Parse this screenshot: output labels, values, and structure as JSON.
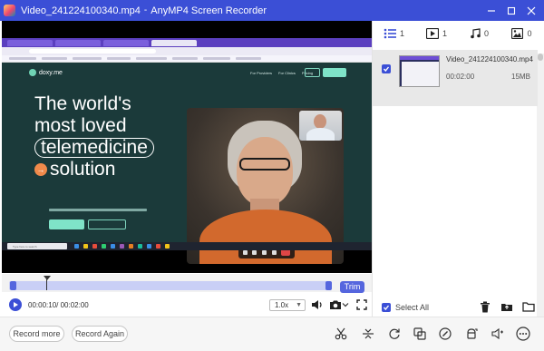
{
  "titlebar": {
    "file_name": "Video_241224100340.mp4",
    "separator": "-",
    "app_name": "AnyMP4 Screen Recorder",
    "window_buttons": [
      "minimize-icon",
      "restore-icon",
      "close-icon"
    ]
  },
  "preview_page": {
    "brand": "doxy.me",
    "nav": [
      "For Providers",
      "For Clinics",
      "Pricing"
    ],
    "hero_line1": "The world's",
    "hero_line2": "most loved",
    "hero_pill": "telemedicine",
    "hero_arrow": "→",
    "hero_line4": "solution",
    "taskbar_search": "Type here to search"
  },
  "media_types": [
    {
      "icon": "list-icon",
      "count": "1"
    },
    {
      "icon": "video-icon",
      "count": "1"
    },
    {
      "icon": "music-note-icon",
      "count": "0"
    },
    {
      "icon": "image-icon",
      "count": "0"
    }
  ],
  "file": {
    "name": "Video_241224100340.mp4",
    "duration": "00:02:00",
    "size": "15MB",
    "checked": true
  },
  "panel": {
    "select_all": "Select All",
    "tools": [
      "trash-icon",
      "export-icon",
      "folder-icon"
    ]
  },
  "timeline": {
    "trim_label": "Trim",
    "playhead_fraction": 0.12
  },
  "controls": {
    "time": "00:00:10/ 00:02:00",
    "speed": "1.0x"
  },
  "bottom": {
    "record_more": "Record more",
    "record_again": "Record Again",
    "edit_tools": [
      "scissors-icon",
      "split-icon",
      "rotate-icon",
      "merge-icon",
      "edit-icon",
      "compress-icon",
      "volume-icon",
      "more-icon"
    ]
  },
  "colors": {
    "accent": "#3b4fd6",
    "timeline_fill": "#c9cff6",
    "trim": "#5566de"
  }
}
